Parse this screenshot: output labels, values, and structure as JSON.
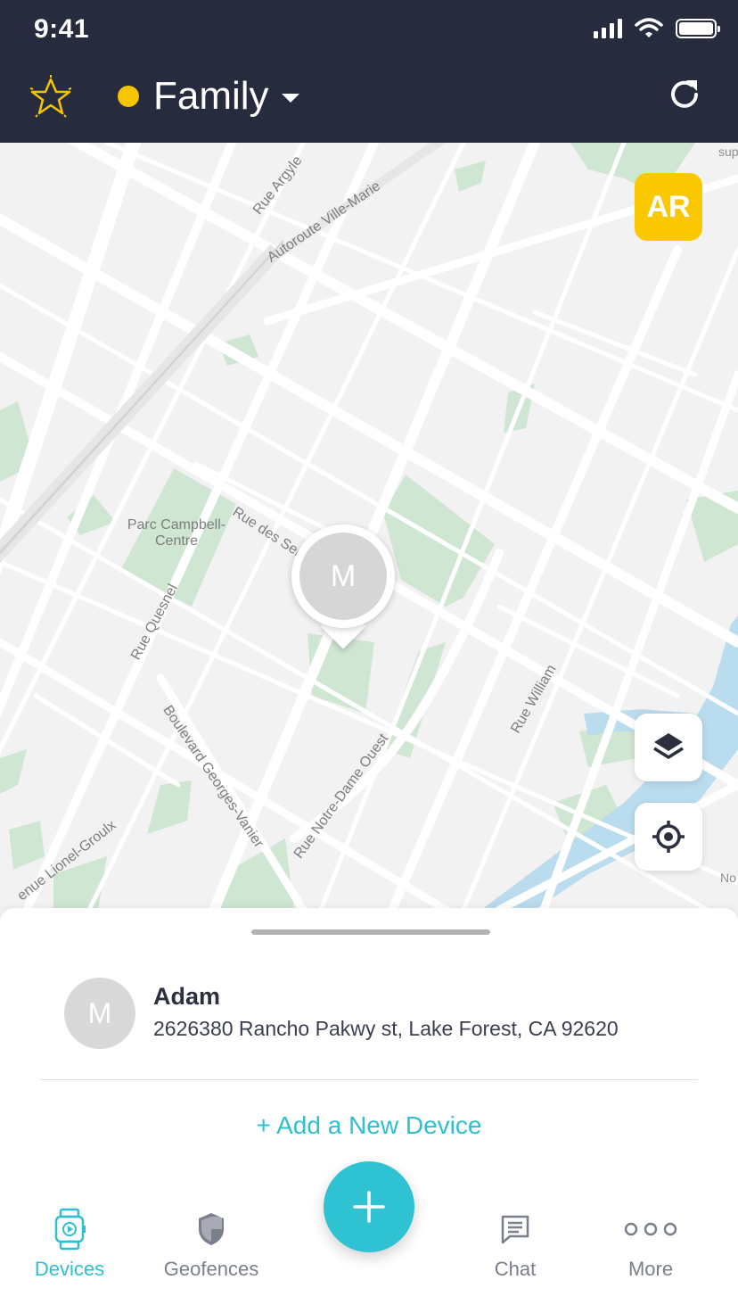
{
  "status_bar": {
    "time": "9:41"
  },
  "header": {
    "group_name": "Family",
    "group_color": "#f6c500",
    "icons": {
      "left": "star-icon",
      "right": "refresh-icon"
    }
  },
  "map": {
    "street_labels": {
      "rue_argyle": "Rue Argyle",
      "autoroute": "Autoroute Ville-Marie",
      "rue_des_sei": "Rue des Sei",
      "rue_quesnel": "Rue Quesnel",
      "boulevard": "Boulevard Georges-Vanier",
      "notre_dame": "Rue Notre-Dame Ouest",
      "rue_william": "Rue William",
      "lionel": "enue Lionel-Groulx"
    },
    "poi": {
      "parc_line1": "Parc Campbell-",
      "parc_line2": "Centre"
    },
    "edge_labels": {
      "top_right": "sup",
      "right": "No"
    },
    "badge": {
      "initials": "AR",
      "color": "#f9c800"
    },
    "pin_initial": "M"
  },
  "sheet": {
    "device": {
      "initial": "M",
      "name": "Adam",
      "address": "2626380 Rancho Pakwy st, Lake Forest, CA 92620"
    },
    "add_device_label": "+ Add a New Device"
  },
  "tabbar": {
    "tabs": [
      {
        "label": "Devices",
        "icon": "watch-icon",
        "active": true
      },
      {
        "label": "Geofences",
        "icon": "shield-icon",
        "active": false
      },
      {
        "label": "Chat",
        "icon": "chat-icon",
        "active": false
      },
      {
        "label": "More",
        "icon": "more-icon",
        "active": false
      }
    ],
    "accent": "#2fbfcf"
  }
}
